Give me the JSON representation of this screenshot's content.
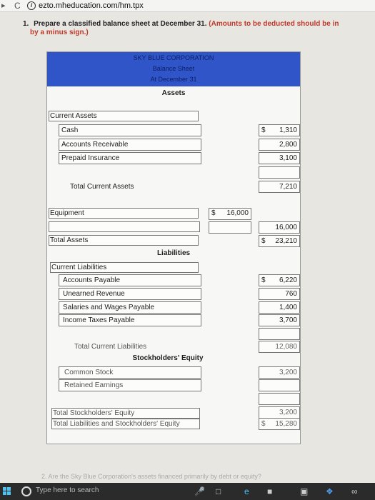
{
  "browser": {
    "url": "ezto.mheducation.com/hm.tpx"
  },
  "question": {
    "number": "1.",
    "text": "Prepare a classified balance sheet at December 31.",
    "hint": "(Amounts to be deducted should be in",
    "text_cont": "by a minus sign.)"
  },
  "sheet": {
    "header": {
      "company": "SKY BLUE CORPORATION",
      "statement": "Balance Sheet",
      "date": "At December 31"
    },
    "assets_title": "Assets",
    "current_assets_label": "Current Assets",
    "current_assets": [
      {
        "label": "Cash",
        "dollar": "$",
        "value": "1,310"
      },
      {
        "label": "Accounts Receivable",
        "dollar": "",
        "value": "2,800"
      },
      {
        "label": "Prepaid Insurance",
        "dollar": "",
        "value": "3,100"
      }
    ],
    "total_current_assets": {
      "label": "Total Current Assets",
      "value": "7,210"
    },
    "equipment": {
      "label": "Equipment",
      "dollar": "$",
      "value": "16,000"
    },
    "equipment_net": "16,000",
    "total_assets": {
      "label": "Total Assets",
      "dollar": "$",
      "value": "23,210"
    },
    "liabilities_title": "Liabilities",
    "current_liabilities_label": "Current Liabilities",
    "current_liabilities": [
      {
        "label": "Accounts Payable",
        "dollar": "$",
        "value": "6,220"
      },
      {
        "label": "Unearned Revenue",
        "dollar": "",
        "value": "760"
      },
      {
        "label": "Salaries and Wages Payable",
        "dollar": "",
        "value": "1,400"
      },
      {
        "label": "Income Taxes Payable",
        "dollar": "",
        "value": "3,700"
      }
    ],
    "total_current_liabilities": {
      "label": "Total Current Liabilities",
      "value": "12,080"
    },
    "equity_title": "Stockholders' Equity",
    "common_stock": {
      "label": "Common Stock",
      "value": "3,200"
    },
    "retained_earnings": {
      "label": "Retained Earnings",
      "value": ""
    },
    "total_equity": {
      "label": "Total Stockholders' Equity",
      "value": "3,200"
    },
    "total_liab_equity": {
      "label": "Total Liabilities and Stockholders' Equity",
      "dollar": "$",
      "value": "15,280"
    }
  },
  "next_question": "2.   Are the Sky Blue Corporation's assets financed primarily by debt or equity?",
  "taskbar": {
    "search_placeholder": "Type here to search"
  }
}
